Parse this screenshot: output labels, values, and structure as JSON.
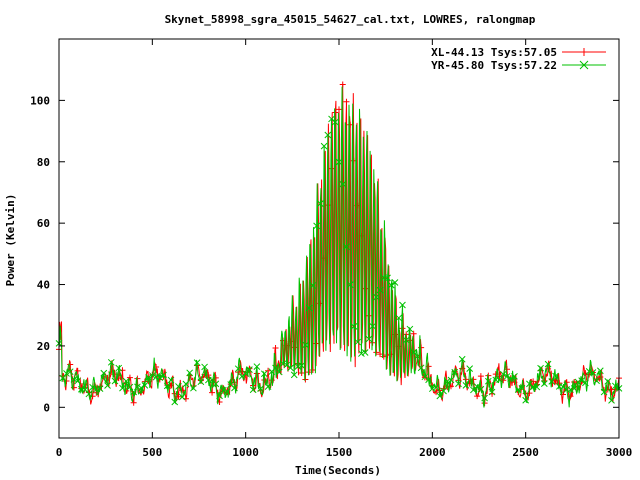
{
  "chart_data": {
    "type": "line",
    "title": "Skynet_58998_sgra_45015_54627_cal.txt, LOWRES, ralongmap",
    "xlabel": "Time(Seconds)",
    "ylabel": "Power (Kelvin)",
    "xlim": [
      0,
      3000
    ],
    "ylim": [
      -10,
      120
    ],
    "xticks": [
      "0",
      "500",
      "1000",
      "1500",
      "2000",
      "2500",
      "3000"
    ],
    "yticks": [
      "0",
      "20",
      "40",
      "60",
      "80",
      "100"
    ],
    "xtick_values": [
      0,
      500,
      1000,
      1500,
      2000,
      2500,
      3000
    ],
    "ytick_values": [
      0,
      20,
      40,
      60,
      80,
      100
    ],
    "grid": false,
    "legend_position": "top-right",
    "baseline": 8,
    "peak_center_x": 1545,
    "scan_period": 19,
    "series": [
      {
        "name": "XL-44.13 Tsys:57.05",
        "color": "#ff0000",
        "marker": "plus",
        "peak": 97,
        "peak_width": 170
      },
      {
        "name": "YR-45.80 Tsys:57.22",
        "color": "#00c000",
        "marker": "cross",
        "peak": 95,
        "peak_width": 175
      }
    ]
  }
}
